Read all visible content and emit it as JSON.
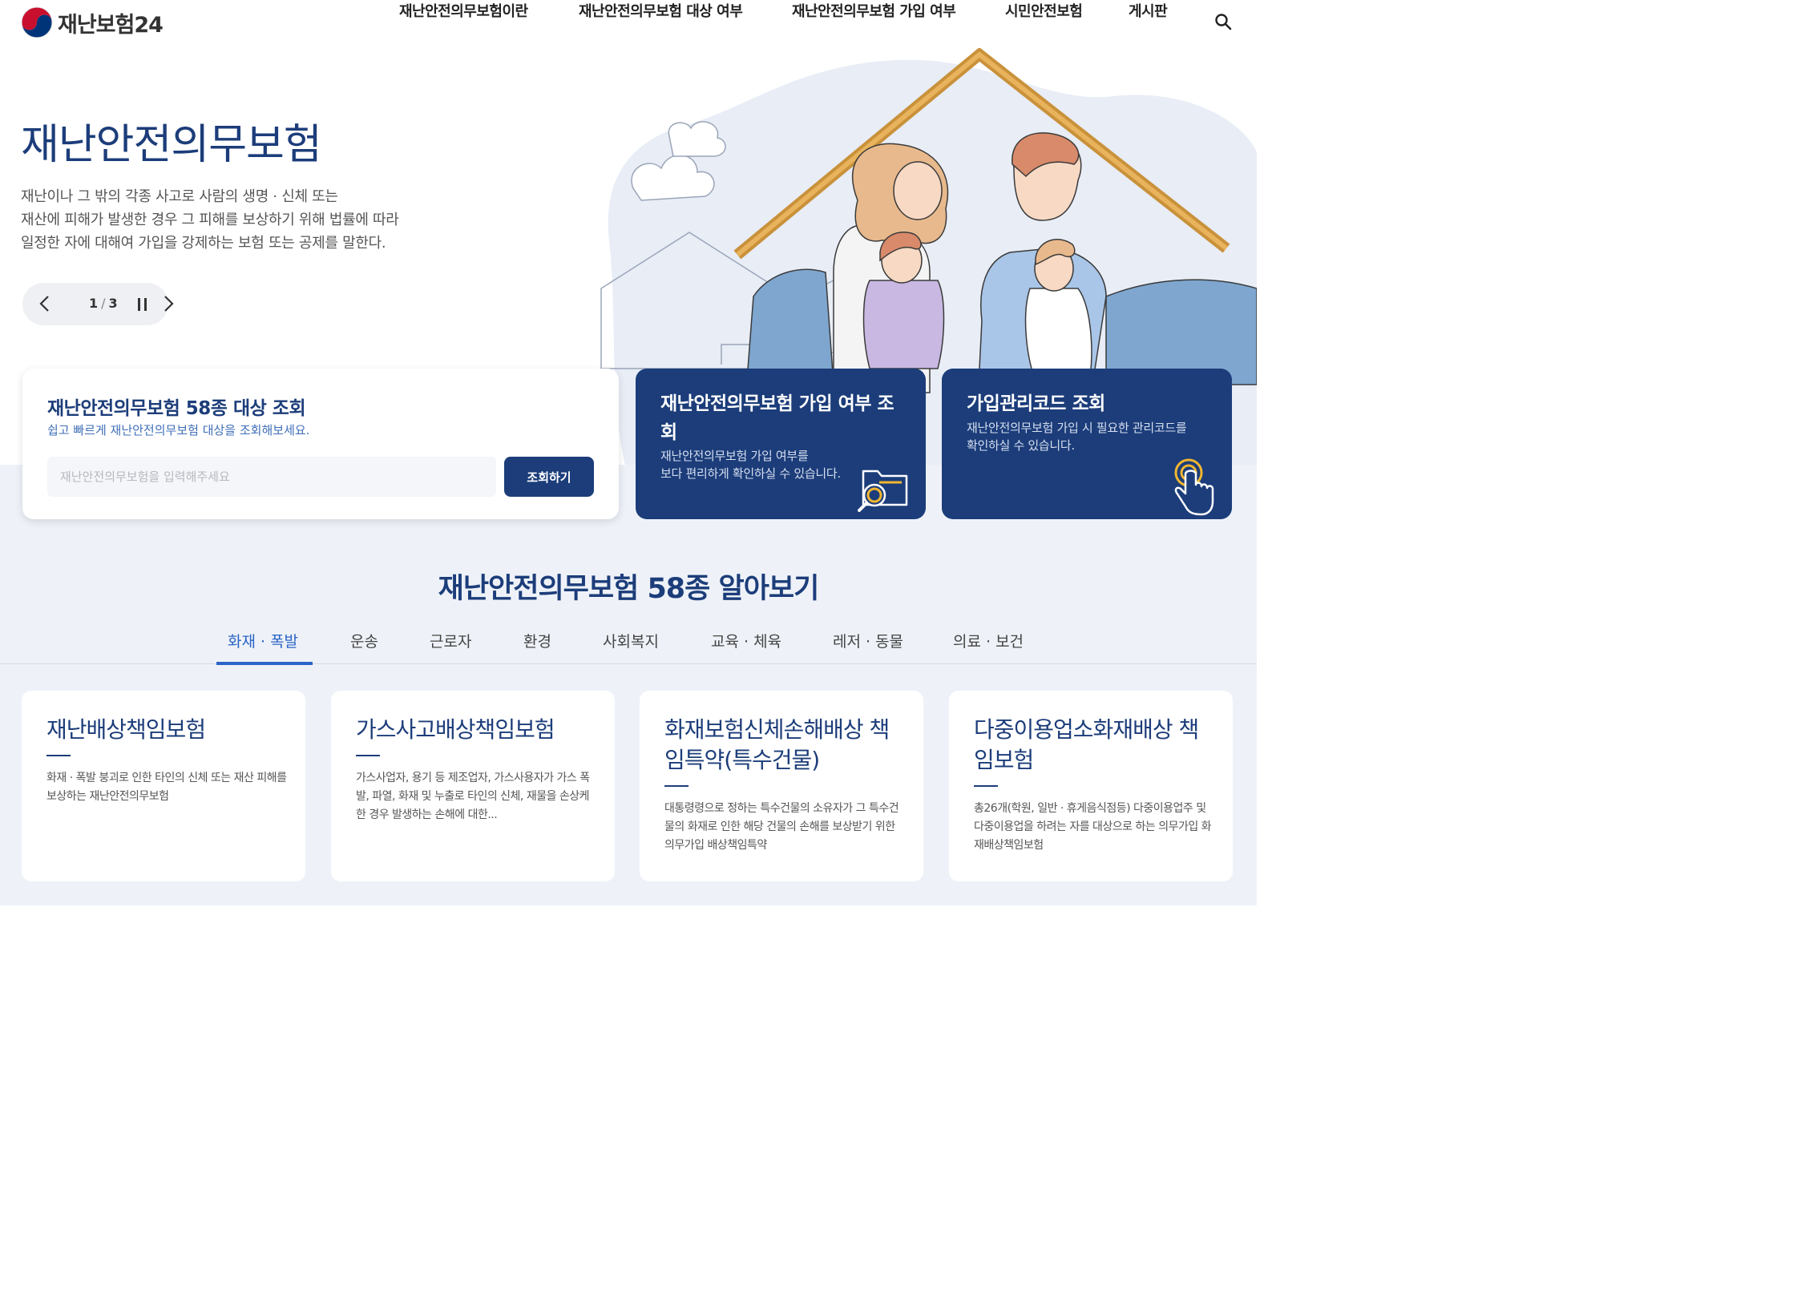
{
  "header": {
    "logo_text": "재난보험24",
    "nav": [
      "재난안전의무보험이란",
      "재난안전의무보험 대상 여부",
      "재난안전의무보험 가입 여부",
      "시민안전보험",
      "게시판"
    ],
    "search_icon": "search-icon"
  },
  "hero": {
    "title": "재난안전의무보험",
    "desc": [
      "재난이나 그 밖의 각종 사고로 사람의 생명 · 신체 또는",
      "재산에 피해가 발생한 경우 그 피해를 보상하기 위해 법률에 따라",
      "일정한 자에 대해여 가입을 강제하는 보험 또는 공제를 말한다."
    ],
    "slider": {
      "current": "1",
      "total": "3",
      "separator": "/"
    }
  },
  "search_card": {
    "title": "재난안전의무보험 58종 대상 조회",
    "subtitle": "쉽고 빠르게 재난안전의무보험 대상을 조회해보세요.",
    "placeholder": "재난안전의무보험을 입력해주세요",
    "button": "조회하기"
  },
  "join_card": {
    "title": "재난안전의무보험 가입 여부 조회",
    "desc": [
      "재난안전의무보험 가입 여부를",
      "보다 편리하게 확인하실 수 있습니다."
    ],
    "icon": "folder-search-icon"
  },
  "code_card": {
    "title": "가입관리코드 조회",
    "desc": [
      "재난안전의무보험 가입 시 필요한 관리코드를",
      "확인하실 수 있습니다."
    ],
    "icon": "touch-hand-icon"
  },
  "section": {
    "title": "재난안전의무보험 58종 알아보기",
    "tabs": [
      "화재 · 폭발",
      "운송",
      "근로자",
      "환경",
      "사회복지",
      "교육 · 체육",
      "레저 · 동물",
      "의료 · 보건"
    ],
    "active_tab": 0
  },
  "insurance_cards": [
    {
      "title": "재난배상책임보험",
      "desc": "화재 · 폭발 붕괴로 인한 타인의 신체 또는 재산 피해를 보상하는 재난안전의무보험"
    },
    {
      "title": "가스사고배상책임보험",
      "desc": "가스사업자, 용기 등 제조업자, 가스사용자가 가스 폭발, 파열, 화재 및 누출로 타인의 신체, 재물을 손상케 한 경우 발생하는 손해에 대한..."
    },
    {
      "title": "화재보험신체손해배상 책임특약(특수건물)",
      "desc": "대통령령으로 정하는 특수건물의 소유자가 그 특수건물의 화재로 인한 해당 건물의 손해를 보상받기 위한 의무가입 배상책임특약"
    },
    {
      "title": "다중이용업소화재배상 책임보험",
      "desc": "총26개(학원, 일반 · 휴게음식점등) 다중이용업주 및 다중이용업을 하려는 자를 대상으로 하는 의무가입 화재배상책임보험"
    }
  ],
  "colors": {
    "primary": "#1c3d7a",
    "accent": "#2b64c6",
    "section_bg": "#eef2f8"
  }
}
